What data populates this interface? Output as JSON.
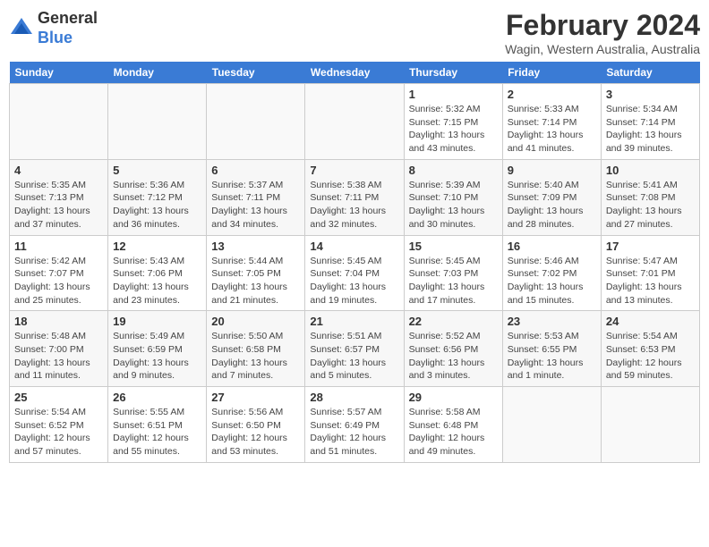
{
  "header": {
    "logo": {
      "general": "General",
      "blue": "Blue"
    },
    "title": "February 2024",
    "location": "Wagin, Western Australia, Australia"
  },
  "weekdays": [
    "Sunday",
    "Monday",
    "Tuesday",
    "Wednesday",
    "Thursday",
    "Friday",
    "Saturday"
  ],
  "weeks": [
    [
      {
        "day": "",
        "info": ""
      },
      {
        "day": "",
        "info": ""
      },
      {
        "day": "",
        "info": ""
      },
      {
        "day": "",
        "info": ""
      },
      {
        "day": "1",
        "info": "Sunrise: 5:32 AM\nSunset: 7:15 PM\nDaylight: 13 hours\nand 43 minutes."
      },
      {
        "day": "2",
        "info": "Sunrise: 5:33 AM\nSunset: 7:14 PM\nDaylight: 13 hours\nand 41 minutes."
      },
      {
        "day": "3",
        "info": "Sunrise: 5:34 AM\nSunset: 7:14 PM\nDaylight: 13 hours\nand 39 minutes."
      }
    ],
    [
      {
        "day": "4",
        "info": "Sunrise: 5:35 AM\nSunset: 7:13 PM\nDaylight: 13 hours\nand 37 minutes."
      },
      {
        "day": "5",
        "info": "Sunrise: 5:36 AM\nSunset: 7:12 PM\nDaylight: 13 hours\nand 36 minutes."
      },
      {
        "day": "6",
        "info": "Sunrise: 5:37 AM\nSunset: 7:11 PM\nDaylight: 13 hours\nand 34 minutes."
      },
      {
        "day": "7",
        "info": "Sunrise: 5:38 AM\nSunset: 7:11 PM\nDaylight: 13 hours\nand 32 minutes."
      },
      {
        "day": "8",
        "info": "Sunrise: 5:39 AM\nSunset: 7:10 PM\nDaylight: 13 hours\nand 30 minutes."
      },
      {
        "day": "9",
        "info": "Sunrise: 5:40 AM\nSunset: 7:09 PM\nDaylight: 13 hours\nand 28 minutes."
      },
      {
        "day": "10",
        "info": "Sunrise: 5:41 AM\nSunset: 7:08 PM\nDaylight: 13 hours\nand 27 minutes."
      }
    ],
    [
      {
        "day": "11",
        "info": "Sunrise: 5:42 AM\nSunset: 7:07 PM\nDaylight: 13 hours\nand 25 minutes."
      },
      {
        "day": "12",
        "info": "Sunrise: 5:43 AM\nSunset: 7:06 PM\nDaylight: 13 hours\nand 23 minutes."
      },
      {
        "day": "13",
        "info": "Sunrise: 5:44 AM\nSunset: 7:05 PM\nDaylight: 13 hours\nand 21 minutes."
      },
      {
        "day": "14",
        "info": "Sunrise: 5:45 AM\nSunset: 7:04 PM\nDaylight: 13 hours\nand 19 minutes."
      },
      {
        "day": "15",
        "info": "Sunrise: 5:45 AM\nSunset: 7:03 PM\nDaylight: 13 hours\nand 17 minutes."
      },
      {
        "day": "16",
        "info": "Sunrise: 5:46 AM\nSunset: 7:02 PM\nDaylight: 13 hours\nand 15 minutes."
      },
      {
        "day": "17",
        "info": "Sunrise: 5:47 AM\nSunset: 7:01 PM\nDaylight: 13 hours\nand 13 minutes."
      }
    ],
    [
      {
        "day": "18",
        "info": "Sunrise: 5:48 AM\nSunset: 7:00 PM\nDaylight: 13 hours\nand 11 minutes."
      },
      {
        "day": "19",
        "info": "Sunrise: 5:49 AM\nSunset: 6:59 PM\nDaylight: 13 hours\nand 9 minutes."
      },
      {
        "day": "20",
        "info": "Sunrise: 5:50 AM\nSunset: 6:58 PM\nDaylight: 13 hours\nand 7 minutes."
      },
      {
        "day": "21",
        "info": "Sunrise: 5:51 AM\nSunset: 6:57 PM\nDaylight: 13 hours\nand 5 minutes."
      },
      {
        "day": "22",
        "info": "Sunrise: 5:52 AM\nSunset: 6:56 PM\nDaylight: 13 hours\nand 3 minutes."
      },
      {
        "day": "23",
        "info": "Sunrise: 5:53 AM\nSunset: 6:55 PM\nDaylight: 13 hours\nand 1 minute."
      },
      {
        "day": "24",
        "info": "Sunrise: 5:54 AM\nSunset: 6:53 PM\nDaylight: 12 hours\nand 59 minutes."
      }
    ],
    [
      {
        "day": "25",
        "info": "Sunrise: 5:54 AM\nSunset: 6:52 PM\nDaylight: 12 hours\nand 57 minutes."
      },
      {
        "day": "26",
        "info": "Sunrise: 5:55 AM\nSunset: 6:51 PM\nDaylight: 12 hours\nand 55 minutes."
      },
      {
        "day": "27",
        "info": "Sunrise: 5:56 AM\nSunset: 6:50 PM\nDaylight: 12 hours\nand 53 minutes."
      },
      {
        "day": "28",
        "info": "Sunrise: 5:57 AM\nSunset: 6:49 PM\nDaylight: 12 hours\nand 51 minutes."
      },
      {
        "day": "29",
        "info": "Sunrise: 5:58 AM\nSunset: 6:48 PM\nDaylight: 12 hours\nand 49 minutes."
      },
      {
        "day": "",
        "info": ""
      },
      {
        "day": "",
        "info": ""
      }
    ]
  ]
}
